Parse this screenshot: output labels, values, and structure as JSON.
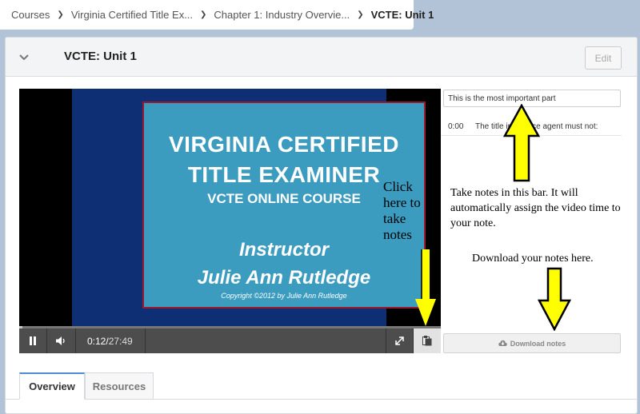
{
  "breadcrumb": {
    "items": [
      "Courses",
      "Virginia Certified Title Ex...",
      "Chapter 1: Industry Overvie..."
    ],
    "current": "VCTE: Unit 1"
  },
  "header": {
    "title": "VCTE: Unit 1",
    "edit_label": "Edit",
    "collapse_icon": "chevron-down-icon"
  },
  "video": {
    "slide": {
      "line1": "VIRGINIA CERTIFIED",
      "line2": "TITLE EXAMINER",
      "line3": "VCTE ONLINE COURSE",
      "line4": "Instructor",
      "line5": "Julie Ann Rutledge",
      "line6": "Copyright ©2012 by Julie Ann Rutledge"
    },
    "current_time": "0:12/",
    "total_time": " 27:49",
    "progress": 0.007,
    "icons": [
      "pause-icon",
      "volume-icon",
      "fullscreen-icon",
      "notes-icon"
    ]
  },
  "notes": {
    "input_value": "This is the most important part",
    "items": [
      {
        "time": "0:00",
        "text": "The title insurance agent must not:"
      }
    ],
    "download_label": "Download notes",
    "download_icon": "cloud-download-icon"
  },
  "tabs": {
    "overview": "Overview",
    "resources": "Resources"
  },
  "annotations": {
    "click_line1": "Click",
    "click_line2": "here to",
    "click_line3": "take",
    "click_line4": "notes",
    "take_notes": "Take notes in this bar. It will automatically assign the video time to your note.",
    "download": "Download your notes here.",
    "arrow_color": "#ffff00"
  }
}
